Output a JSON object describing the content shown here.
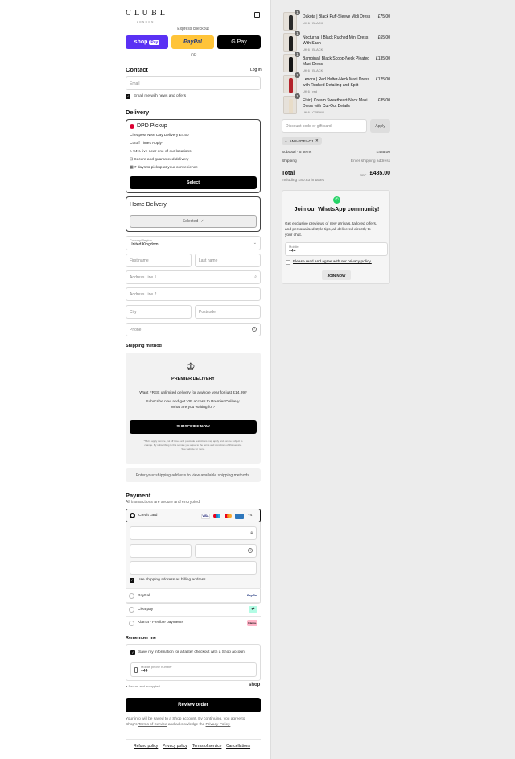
{
  "brand": {
    "logo": "CLUBL",
    "sub": "LONDON"
  },
  "express": {
    "title": "Express checkout",
    "shop": "shop",
    "shop_pay": "Pay",
    "paypal": "PayPal",
    "gpay": "G Pay",
    "or": "OR"
  },
  "contact": {
    "heading": "Contact",
    "login": "Log in",
    "email_placeholder": "Email",
    "news_label": "Email me with news and offers"
  },
  "delivery": {
    "heading": "Delivery",
    "dpd": {
      "title": "DPD Pickup",
      "price": "Cheapest Next Day Delivery £4.50",
      "cutoff": "Cutoff Times Apply*",
      "bullets": [
        "94% live near one of our locations",
        "Secure and guaranteed delivery",
        "7 days to pickup at your convenience"
      ],
      "select": "Select"
    },
    "home": {
      "title": "Home Delivery",
      "selected": "Selected"
    },
    "country_label": "Country/Region",
    "country_value": "United Kingdom",
    "first_name": "First name",
    "last_name": "Last name",
    "address1": "Address Line 1",
    "address2": "Address Line 2",
    "city": "City",
    "postcode": "Postcode",
    "phone": "Phone"
  },
  "shipping": {
    "heading": "Shipping method",
    "premier_title": "PREMIER DELIVERY",
    "premier_line1": "Want FREE unlimited delivery for a whole year for just £14.99?",
    "premier_line2": "Subscribe now and get VIP access to Premier Delivery.",
    "premier_line3": "What are you waiting for?",
    "subscribe": "SUBSCRIBE NOW",
    "fine1": "*T&Cs apply service, cut off times and postcode restrictions may apply and can be subject to",
    "fine2": "change. By subscribing to this service you agree to the terms and conditions of this service.",
    "fine3": "See website for more.",
    "notice": "Enter your shipping address to view available shipping methods."
  },
  "payment": {
    "heading": "Payment",
    "sub": "All transactions are secure and encrypted.",
    "credit_card": "Credit card",
    "more_cards": "+4",
    "billing_same": "Use shipping address as billing address",
    "paypal": "PayPal",
    "paypal_logo": "PayPal",
    "clearpay": "Clearpay",
    "klarna": "Klarna - Flexible payments",
    "klarna_logo": "Klarna."
  },
  "remember": {
    "heading": "Remember me",
    "save_label": "Save my information for a faster checkout with a Shop account",
    "mobile_label": "Mobile phone number",
    "mobile_value": "+44",
    "secure": "Secure and encrypted",
    "shop": "shop"
  },
  "review": {
    "button": "Review order",
    "disclaimer1": "Your info will be saved to a Shop account. By continuing, you agree to",
    "disclaimer2_prefix": "Shop's",
    "terms": "Terms of Service",
    "and": "and acknowledge the",
    "privacy": "Privacy Policy."
  },
  "footer": [
    "Refund policy",
    "Privacy policy",
    "Terms of service",
    "Cancellations"
  ],
  "cart": {
    "items": [
      {
        "qty": "1",
        "name": "Dakota | Black Puff-Sleeve Midi Dress",
        "variant": "UK 6 / BLACK",
        "price": "£75.00",
        "color": "#2a2a2a"
      },
      {
        "qty": "1",
        "name": "Nocturnal | Black Ruched Mini Dress With Sash",
        "variant": "UK 6 / BLACK",
        "price": "£65.00",
        "color": "#1e1e1e"
      },
      {
        "qty": "1",
        "name": "Bambina | Black Scoop-Neck Pleated Maxi Dress",
        "variant": "UK 6 / BLACK",
        "price": "£135.00",
        "color": "#151515"
      },
      {
        "qty": "1",
        "name": "Lenora | Red Halter-Neck Maxi Dress with Ruched Detailing and Split",
        "variant": "UK 6 / red",
        "price": "£125.00",
        "color": "#b3232b"
      },
      {
        "qty": "1",
        "name": "Elsir | Cream Sweetheart-Neck Maxi Dress with Cut-Out Details",
        "variant": "UK 6 / CREAM",
        "price": "£85.00",
        "color": "#e8dcc8"
      }
    ],
    "discount_placeholder": "Discount code or gift card",
    "apply": "Apply",
    "code": "ANS-FDEL-CJ",
    "subtotal_label": "Subtotal · 5 items",
    "subtotal_value": "£485.00",
    "shipping_label": "Shipping",
    "shipping_value": "Enter shipping address",
    "total_label": "Total",
    "currency": "GBP",
    "total_value": "£485.00",
    "taxes": "Including £80.83 in taxes"
  },
  "whatsapp": {
    "title": "Join our WhatsApp community!",
    "text1": "Get exclusive previews of new arrivals, tailored offers,",
    "text2": "and personalised style tips, all delivered directly to",
    "text3": "your chat.",
    "mobile_label": "Mobile",
    "mobile_value": "+44",
    "agree": "Please read and agree with our privacy policy.",
    "join": "JOIN NOW"
  }
}
